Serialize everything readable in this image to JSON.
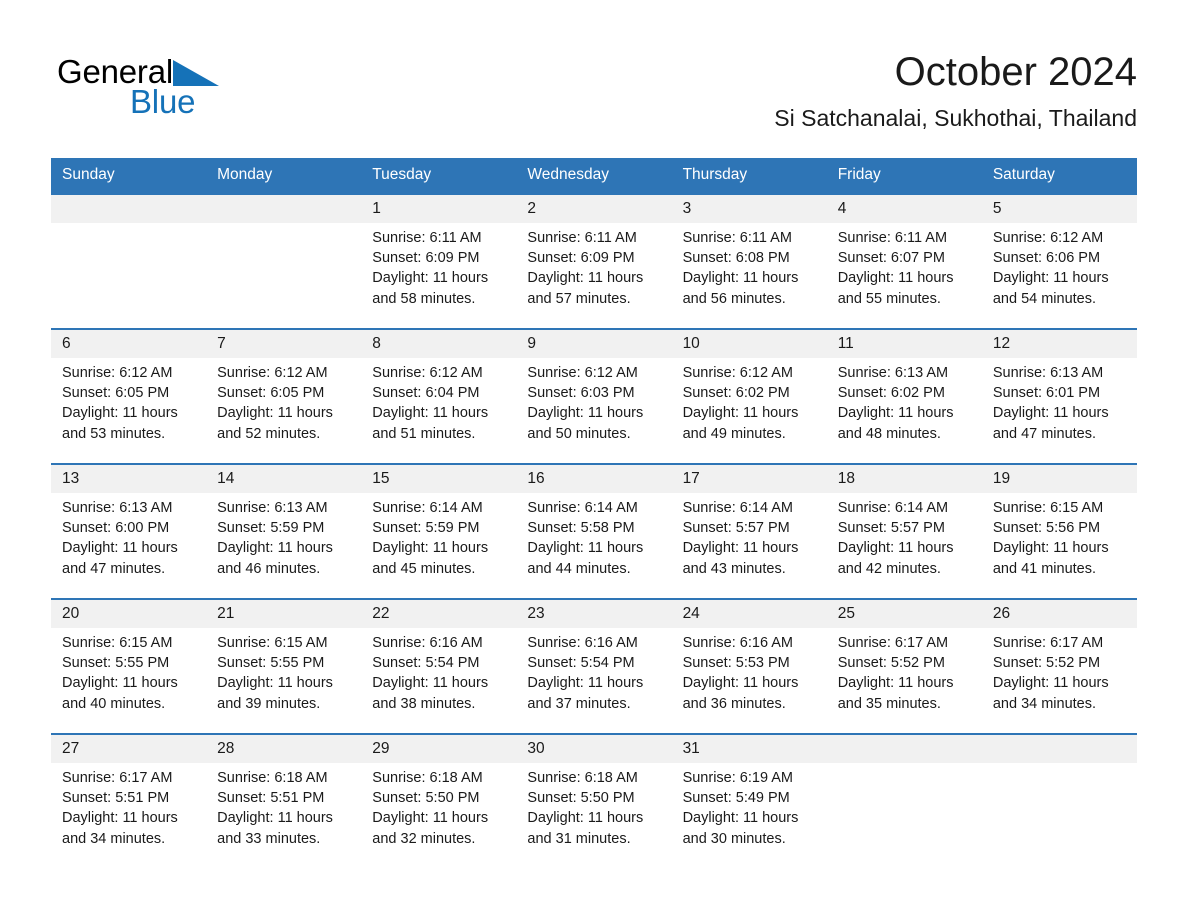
{
  "brand": {
    "name_part1": "General",
    "name_part2": "Blue",
    "triangle_color": "#1572b8"
  },
  "header": {
    "month_title": "October 2024",
    "location": "Si Satchanalai, Sukhothai, Thailand"
  },
  "theme": {
    "header_blue": "#2e75b6",
    "daynum_gray": "#f1f1f1",
    "text_dark": "#1a1a1a",
    "brand_blue": "#1572b8"
  },
  "calendar": {
    "weekday_headers": [
      "Sunday",
      "Monday",
      "Tuesday",
      "Wednesday",
      "Thursday",
      "Friday",
      "Saturday"
    ],
    "weeks": [
      [
        {
          "day": "",
          "empty": true,
          "sunrise": "",
          "sunset": "",
          "daylight_l1": "",
          "daylight_l2": ""
        },
        {
          "day": "",
          "empty": true,
          "sunrise": "",
          "sunset": "",
          "daylight_l1": "",
          "daylight_l2": ""
        },
        {
          "day": "1",
          "empty": false,
          "sunrise": "Sunrise: 6:11 AM",
          "sunset": "Sunset: 6:09 PM",
          "daylight_l1": "Daylight: 11 hours",
          "daylight_l2": "and 58 minutes."
        },
        {
          "day": "2",
          "empty": false,
          "sunrise": "Sunrise: 6:11 AM",
          "sunset": "Sunset: 6:09 PM",
          "daylight_l1": "Daylight: 11 hours",
          "daylight_l2": "and 57 minutes."
        },
        {
          "day": "3",
          "empty": false,
          "sunrise": "Sunrise: 6:11 AM",
          "sunset": "Sunset: 6:08 PM",
          "daylight_l1": "Daylight: 11 hours",
          "daylight_l2": "and 56 minutes."
        },
        {
          "day": "4",
          "empty": false,
          "sunrise": "Sunrise: 6:11 AM",
          "sunset": "Sunset: 6:07 PM",
          "daylight_l1": "Daylight: 11 hours",
          "daylight_l2": "and 55 minutes."
        },
        {
          "day": "5",
          "empty": false,
          "sunrise": "Sunrise: 6:12 AM",
          "sunset": "Sunset: 6:06 PM",
          "daylight_l1": "Daylight: 11 hours",
          "daylight_l2": "and 54 minutes."
        }
      ],
      [
        {
          "day": "6",
          "empty": false,
          "sunrise": "Sunrise: 6:12 AM",
          "sunset": "Sunset: 6:05 PM",
          "daylight_l1": "Daylight: 11 hours",
          "daylight_l2": "and 53 minutes."
        },
        {
          "day": "7",
          "empty": false,
          "sunrise": "Sunrise: 6:12 AM",
          "sunset": "Sunset: 6:05 PM",
          "daylight_l1": "Daylight: 11 hours",
          "daylight_l2": "and 52 minutes."
        },
        {
          "day": "8",
          "empty": false,
          "sunrise": "Sunrise: 6:12 AM",
          "sunset": "Sunset: 6:04 PM",
          "daylight_l1": "Daylight: 11 hours",
          "daylight_l2": "and 51 minutes."
        },
        {
          "day": "9",
          "empty": false,
          "sunrise": "Sunrise: 6:12 AM",
          "sunset": "Sunset: 6:03 PM",
          "daylight_l1": "Daylight: 11 hours",
          "daylight_l2": "and 50 minutes."
        },
        {
          "day": "10",
          "empty": false,
          "sunrise": "Sunrise: 6:12 AM",
          "sunset": "Sunset: 6:02 PM",
          "daylight_l1": "Daylight: 11 hours",
          "daylight_l2": "and 49 minutes."
        },
        {
          "day": "11",
          "empty": false,
          "sunrise": "Sunrise: 6:13 AM",
          "sunset": "Sunset: 6:02 PM",
          "daylight_l1": "Daylight: 11 hours",
          "daylight_l2": "and 48 minutes."
        },
        {
          "day": "12",
          "empty": false,
          "sunrise": "Sunrise: 6:13 AM",
          "sunset": "Sunset: 6:01 PM",
          "daylight_l1": "Daylight: 11 hours",
          "daylight_l2": "and 47 minutes."
        }
      ],
      [
        {
          "day": "13",
          "empty": false,
          "sunrise": "Sunrise: 6:13 AM",
          "sunset": "Sunset: 6:00 PM",
          "daylight_l1": "Daylight: 11 hours",
          "daylight_l2": "and 47 minutes."
        },
        {
          "day": "14",
          "empty": false,
          "sunrise": "Sunrise: 6:13 AM",
          "sunset": "Sunset: 5:59 PM",
          "daylight_l1": "Daylight: 11 hours",
          "daylight_l2": "and 46 minutes."
        },
        {
          "day": "15",
          "empty": false,
          "sunrise": "Sunrise: 6:14 AM",
          "sunset": "Sunset: 5:59 PM",
          "daylight_l1": "Daylight: 11 hours",
          "daylight_l2": "and 45 minutes."
        },
        {
          "day": "16",
          "empty": false,
          "sunrise": "Sunrise: 6:14 AM",
          "sunset": "Sunset: 5:58 PM",
          "daylight_l1": "Daylight: 11 hours",
          "daylight_l2": "and 44 minutes."
        },
        {
          "day": "17",
          "empty": false,
          "sunrise": "Sunrise: 6:14 AM",
          "sunset": "Sunset: 5:57 PM",
          "daylight_l1": "Daylight: 11 hours",
          "daylight_l2": "and 43 minutes."
        },
        {
          "day": "18",
          "empty": false,
          "sunrise": "Sunrise: 6:14 AM",
          "sunset": "Sunset: 5:57 PM",
          "daylight_l1": "Daylight: 11 hours",
          "daylight_l2": "and 42 minutes."
        },
        {
          "day": "19",
          "empty": false,
          "sunrise": "Sunrise: 6:15 AM",
          "sunset": "Sunset: 5:56 PM",
          "daylight_l1": "Daylight: 11 hours",
          "daylight_l2": "and 41 minutes."
        }
      ],
      [
        {
          "day": "20",
          "empty": false,
          "sunrise": "Sunrise: 6:15 AM",
          "sunset": "Sunset: 5:55 PM",
          "daylight_l1": "Daylight: 11 hours",
          "daylight_l2": "and 40 minutes."
        },
        {
          "day": "21",
          "empty": false,
          "sunrise": "Sunrise: 6:15 AM",
          "sunset": "Sunset: 5:55 PM",
          "daylight_l1": "Daylight: 11 hours",
          "daylight_l2": "and 39 minutes."
        },
        {
          "day": "22",
          "empty": false,
          "sunrise": "Sunrise: 6:16 AM",
          "sunset": "Sunset: 5:54 PM",
          "daylight_l1": "Daylight: 11 hours",
          "daylight_l2": "and 38 minutes."
        },
        {
          "day": "23",
          "empty": false,
          "sunrise": "Sunrise: 6:16 AM",
          "sunset": "Sunset: 5:54 PM",
          "daylight_l1": "Daylight: 11 hours",
          "daylight_l2": "and 37 minutes."
        },
        {
          "day": "24",
          "empty": false,
          "sunrise": "Sunrise: 6:16 AM",
          "sunset": "Sunset: 5:53 PM",
          "daylight_l1": "Daylight: 11 hours",
          "daylight_l2": "and 36 minutes."
        },
        {
          "day": "25",
          "empty": false,
          "sunrise": "Sunrise: 6:17 AM",
          "sunset": "Sunset: 5:52 PM",
          "daylight_l1": "Daylight: 11 hours",
          "daylight_l2": "and 35 minutes."
        },
        {
          "day": "26",
          "empty": false,
          "sunrise": "Sunrise: 6:17 AM",
          "sunset": "Sunset: 5:52 PM",
          "daylight_l1": "Daylight: 11 hours",
          "daylight_l2": "and 34 minutes."
        }
      ],
      [
        {
          "day": "27",
          "empty": false,
          "sunrise": "Sunrise: 6:17 AM",
          "sunset": "Sunset: 5:51 PM",
          "daylight_l1": "Daylight: 11 hours",
          "daylight_l2": "and 34 minutes."
        },
        {
          "day": "28",
          "empty": false,
          "sunrise": "Sunrise: 6:18 AM",
          "sunset": "Sunset: 5:51 PM",
          "daylight_l1": "Daylight: 11 hours",
          "daylight_l2": "and 33 minutes."
        },
        {
          "day": "29",
          "empty": false,
          "sunrise": "Sunrise: 6:18 AM",
          "sunset": "Sunset: 5:50 PM",
          "daylight_l1": "Daylight: 11 hours",
          "daylight_l2": "and 32 minutes."
        },
        {
          "day": "30",
          "empty": false,
          "sunrise": "Sunrise: 6:18 AM",
          "sunset": "Sunset: 5:50 PM",
          "daylight_l1": "Daylight: 11 hours",
          "daylight_l2": "and 31 minutes."
        },
        {
          "day": "31",
          "empty": false,
          "sunrise": "Sunrise: 6:19 AM",
          "sunset": "Sunset: 5:49 PM",
          "daylight_l1": "Daylight: 11 hours",
          "daylight_l2": "and 30 minutes."
        },
        {
          "day": "",
          "empty": true,
          "sunrise": "",
          "sunset": "",
          "daylight_l1": "",
          "daylight_l2": ""
        },
        {
          "day": "",
          "empty": true,
          "sunrise": "",
          "sunset": "",
          "daylight_l1": "",
          "daylight_l2": ""
        }
      ]
    ]
  }
}
